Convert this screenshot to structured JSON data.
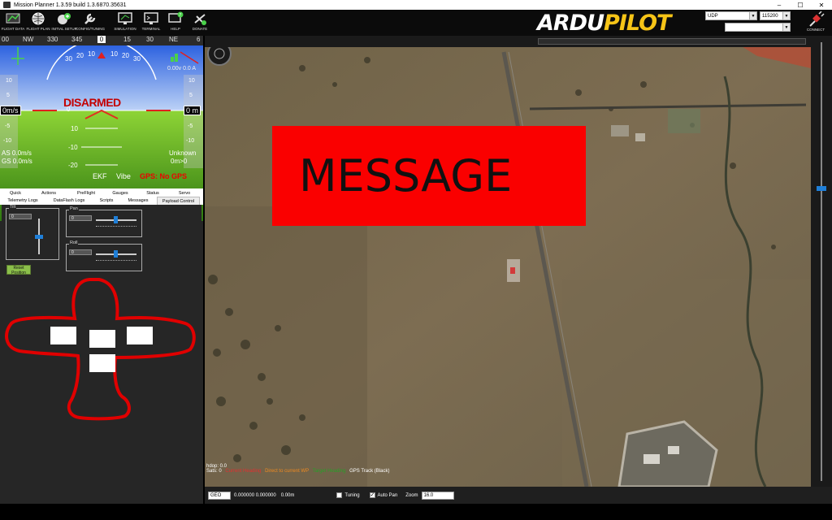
{
  "window": {
    "title": "Mission Planner 1.3.59 build 1.3.6870.35631",
    "controls": [
      "–",
      "☐",
      "✕"
    ]
  },
  "menu": {
    "items": [
      {
        "label": "FLIGHT DATA",
        "icon": "flight-data-icon"
      },
      {
        "label": "FLIGHT PLAN",
        "icon": "globe-icon"
      },
      {
        "label": "INITIAL SETUP",
        "icon": "initial-setup-icon"
      },
      {
        "label": "CONFIG/TUNING",
        "icon": "wrench-icon"
      },
      {
        "label": "SIMULATION",
        "icon": "monitor-icon"
      },
      {
        "label": "TERMINAL",
        "icon": "terminal-icon"
      },
      {
        "label": "HELP",
        "icon": "help-icon"
      },
      {
        "label": "DONATE",
        "icon": "donate-icon"
      }
    ],
    "logo_a": "ARDU",
    "logo_b": "PILOT",
    "protocol": "UDP",
    "baud": "115200",
    "port": "",
    "connect_label": "CONNECT"
  },
  "heading": {
    "ticks": [
      "00",
      "NW",
      "330",
      "345",
      "0",
      "15",
      "30",
      "NE",
      "6"
    ]
  },
  "hud": {
    "status": "DISARMED",
    "pitch_labels": [
      "30",
      "20",
      "10",
      "0",
      "10",
      "20",
      "30"
    ],
    "pitch_ladder": [
      "10",
      "0",
      "-10",
      "-20"
    ],
    "left_scale": [
      "10",
      "5",
      "-5",
      "-10"
    ],
    "right_scale": [
      "10",
      "5",
      "-5",
      "-10"
    ],
    "airspeed": "0m/s",
    "altitude": "0 m",
    "as_text": "AS 0.0m/s",
    "gs_text": "GS 0.0m/s",
    "mode": "Unknown",
    "dist": "0m>0",
    "ekf": "EKF",
    "vibe": "Vibe",
    "gps": "GPS: No GPS",
    "battery": "0.00v 0.0 A"
  },
  "tabs": {
    "row1": [
      "Quick",
      "Actions",
      "PreFlight",
      "Gauges",
      "Status",
      "Servo"
    ],
    "row2": [
      "Telemetry Logs",
      "DataFlash Logs",
      "Scripts",
      "Messages",
      "Payload Control"
    ],
    "active": "Payload Control"
  },
  "payload": {
    "tilt_label": "Tilt",
    "tilt_value": "0",
    "pan_label": "Pan",
    "pan_value": "0",
    "roll_label": "Roll",
    "roll_value": "0",
    "reset_label": "Reset Position"
  },
  "map": {
    "message": "MESSAGE",
    "hdop": "hdop: 0.0",
    "sats": "Sats: 0",
    "legend": [
      {
        "label": "Current Heading",
        "color": "#e03030"
      },
      {
        "label": "Direct to current WP",
        "color": "#f08a20"
      },
      {
        "label": "Target Heading",
        "color": "#27a027"
      },
      {
        "label": "GPS Track (Black)",
        "color": "#000000"
      }
    ]
  },
  "bottom": {
    "coord_type": "GEO",
    "coords": "0.000000 0.000000",
    "alt": "0.00m",
    "tuning_label": "Tuning",
    "autopan_label": "Auto Pan",
    "zoom_label": "Zoom",
    "zoom_value": "16.0"
  }
}
